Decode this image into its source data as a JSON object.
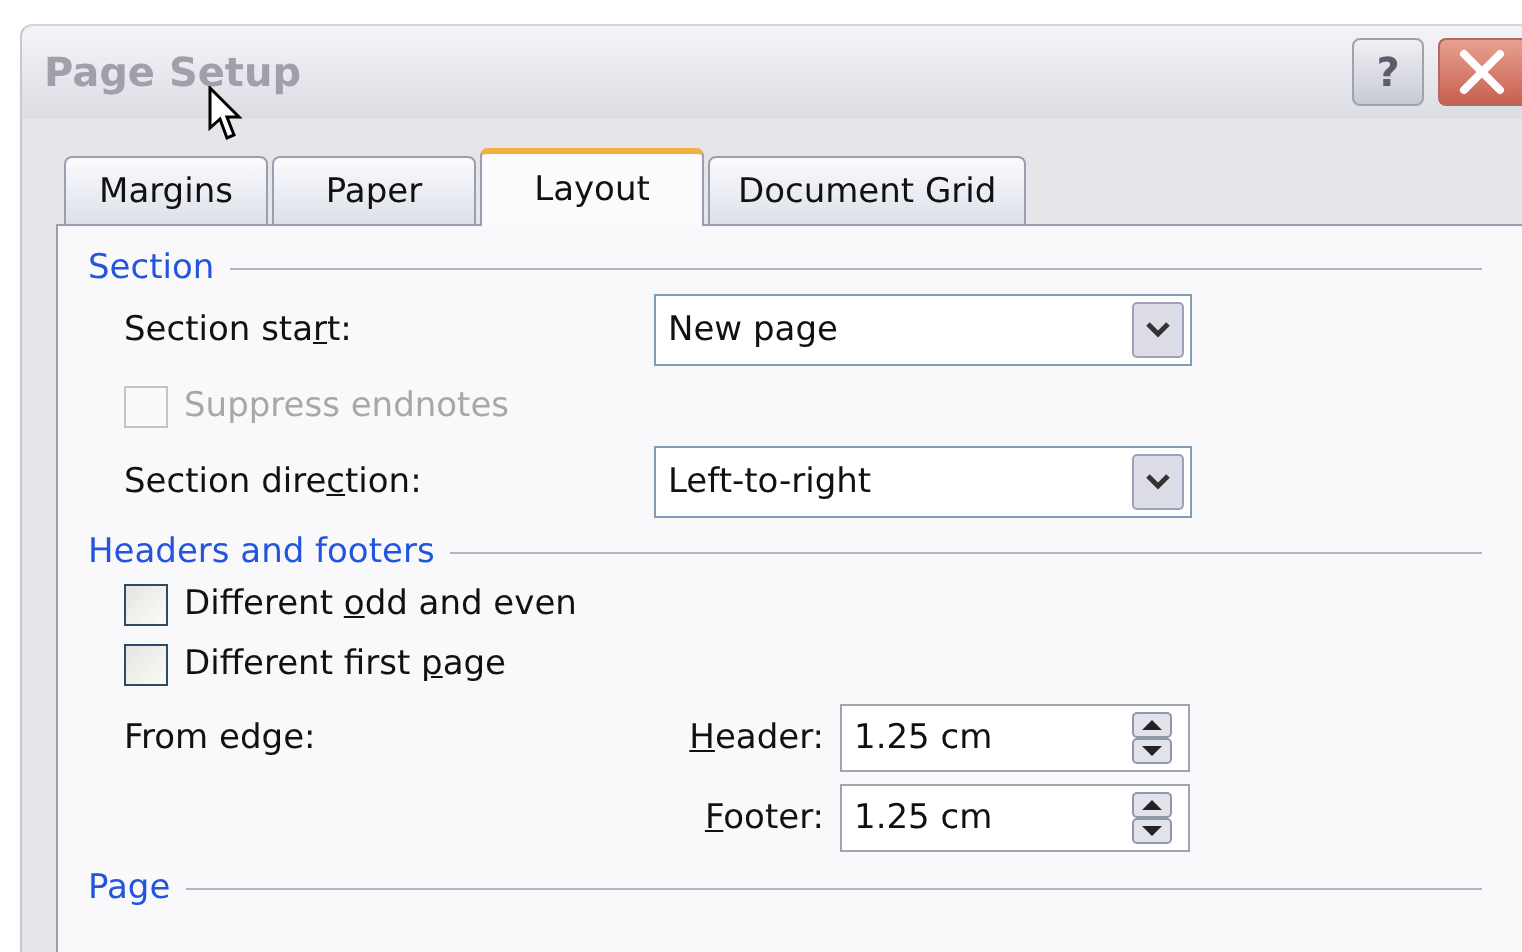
{
  "window": {
    "title": "Page Setup",
    "help_button": "?"
  },
  "tabs": [
    {
      "label": "Margins",
      "selected": false
    },
    {
      "label": "Paper",
      "selected": false
    },
    {
      "label": "Layout",
      "selected": true
    },
    {
      "label": "Document Grid",
      "selected": false
    }
  ],
  "sections": [
    {
      "heading": "Section",
      "rows": [
        {
          "kind": "combo",
          "label": [
            {
              "text": "Section sta"
            },
            {
              "text": "r",
              "access_key": true
            },
            {
              "text": "t:"
            }
          ],
          "value": "New page"
        },
        {
          "kind": "checkbox",
          "label": [
            {
              "text": "Suppress endnotes"
            }
          ],
          "checked": false,
          "disabled": true
        },
        {
          "kind": "combo",
          "label": [
            {
              "text": "Section dire"
            },
            {
              "text": "c",
              "access_key": true
            },
            {
              "text": "tion:"
            }
          ],
          "value": "Left-to-right"
        }
      ]
    },
    {
      "heading": "Headers and footers",
      "rows": [
        {
          "kind": "checkbox",
          "label": [
            {
              "text": "Different "
            },
            {
              "text": "o",
              "access_key": true
            },
            {
              "text": "dd and even"
            }
          ],
          "checked": false,
          "disabled": false
        },
        {
          "kind": "checkbox",
          "label": [
            {
              "text": "Different first "
            },
            {
              "text": "p",
              "access_key": true
            },
            {
              "text": "age"
            }
          ],
          "checked": false,
          "disabled": false
        },
        {
          "kind": "spin",
          "label": [
            {
              "text": "From edge:"
            }
          ],
          "field_label": [
            {
              "text": "H",
              "access_key": true
            },
            {
              "text": "eader:"
            }
          ],
          "value": "1.25 cm"
        },
        {
          "kind": "spin",
          "field_label": [
            {
              "text": "F",
              "access_key": true
            },
            {
              "text": "ooter:"
            }
          ],
          "value": "1.25 cm"
        }
      ]
    },
    {
      "heading": "Page"
    }
  ]
}
